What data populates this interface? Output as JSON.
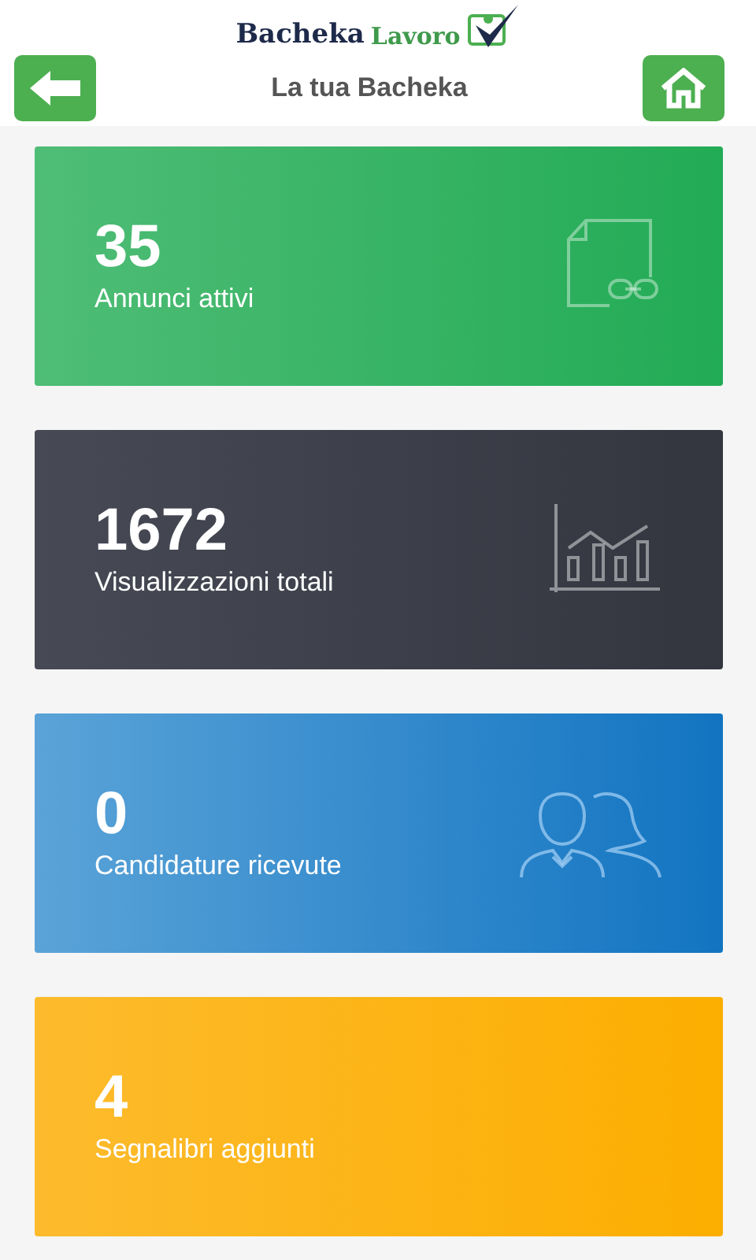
{
  "logo": {
    "primary": "Bacheka",
    "secondary": "Lavoro"
  },
  "header": {
    "title": "La tua Bacheka"
  },
  "cards": [
    {
      "kind": "ads",
      "value": "35",
      "label": "Annunci attivi"
    },
    {
      "kind": "views",
      "value": "1672",
      "label": "Visualizzazioni totali"
    },
    {
      "kind": "applications",
      "value": "0",
      "label": "Candidature ricevute"
    },
    {
      "kind": "bookmarks",
      "value": "4",
      "label": "Segnalibri aggiunti"
    }
  ]
}
